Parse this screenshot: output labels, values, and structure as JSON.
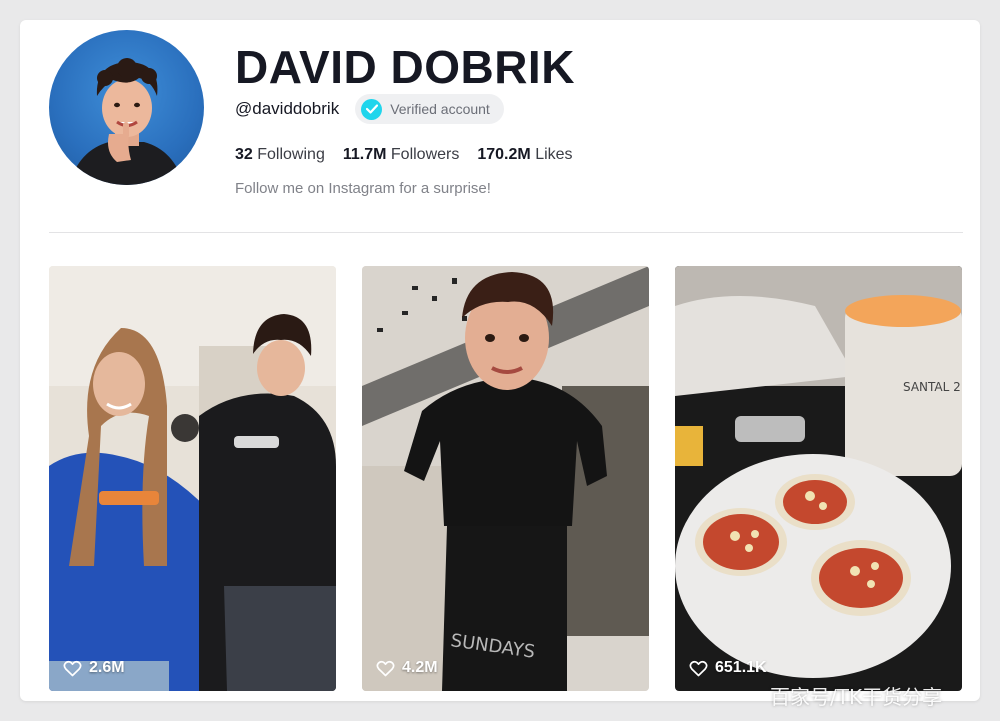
{
  "profile": {
    "display_name": "DAVID DOBRIK",
    "handle": "@daviddobrik",
    "verified_label": "Verified account",
    "bio": "Follow me on Instagram for a surprise!",
    "stats": [
      {
        "value": "32",
        "label": "Following"
      },
      {
        "value": "11.7M",
        "label": "Followers"
      },
      {
        "value": "170.2M",
        "label": "Likes"
      }
    ]
  },
  "videos": [
    {
      "likes": "2.6M",
      "icon": "heart-outline-icon"
    },
    {
      "likes": "4.2M",
      "icon": "heart-outline-icon"
    },
    {
      "likes": "651.1K",
      "icon": "heart-outline-icon"
    }
  ],
  "watermark": "百家号/TK干货分享",
  "colors": {
    "verified_badge": "#20d5ec",
    "text_primary": "#161823",
    "text_secondary": "#808289",
    "avatar_bg": "#2a6fbd"
  }
}
